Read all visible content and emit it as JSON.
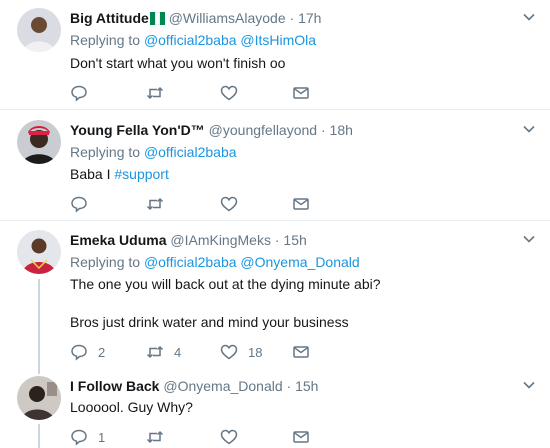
{
  "tweets": [
    {
      "name": "Big Attitude",
      "handle": "@WilliamsAlayode",
      "dot": "·",
      "time": "17h",
      "replying_label": "Replying to",
      "replying_to": [
        "@official2baba",
        "@ItsHimOla"
      ],
      "text": "Don't start what you won't finish oo",
      "reply_count": "",
      "retweet_count": "",
      "like_count": "",
      "flag_colors": [
        "#008751",
        "#ffffff",
        "#008751"
      ]
    },
    {
      "name": "Young Fella Yon'D™",
      "handle": "@youngfellayond",
      "dot": "·",
      "time": "18h",
      "replying_label": "Replying to",
      "replying_to": [
        "@official2baba"
      ],
      "text_plain": "Baba I ",
      "text_hashtag": "#support",
      "reply_count": "",
      "retweet_count": "",
      "like_count": ""
    },
    {
      "name": "Emeka Uduma",
      "handle": "@IAmKingMeks",
      "dot": "·",
      "time": "15h",
      "replying_label": "Replying to",
      "replying_to": [
        "@official2baba",
        "@Onyema_Donald"
      ],
      "text_line1": "The one you will back out at the dying minute abi?",
      "text_line2": "Bros just drink water and mind your business",
      "reply_count": "2",
      "retweet_count": "4",
      "like_count": "18"
    },
    {
      "name": "I Follow Back",
      "handle": "@Onyema_Donald",
      "dot": "·",
      "time": "15h",
      "text": "Loooool. Guy Why?",
      "reply_count": "1",
      "retweet_count": "",
      "like_count": ""
    }
  ],
  "colors": {
    "link": "#1b95e0",
    "muted": "#657786",
    "separator": "#e6ecf0",
    "thread_line": "#ccd6dd"
  }
}
